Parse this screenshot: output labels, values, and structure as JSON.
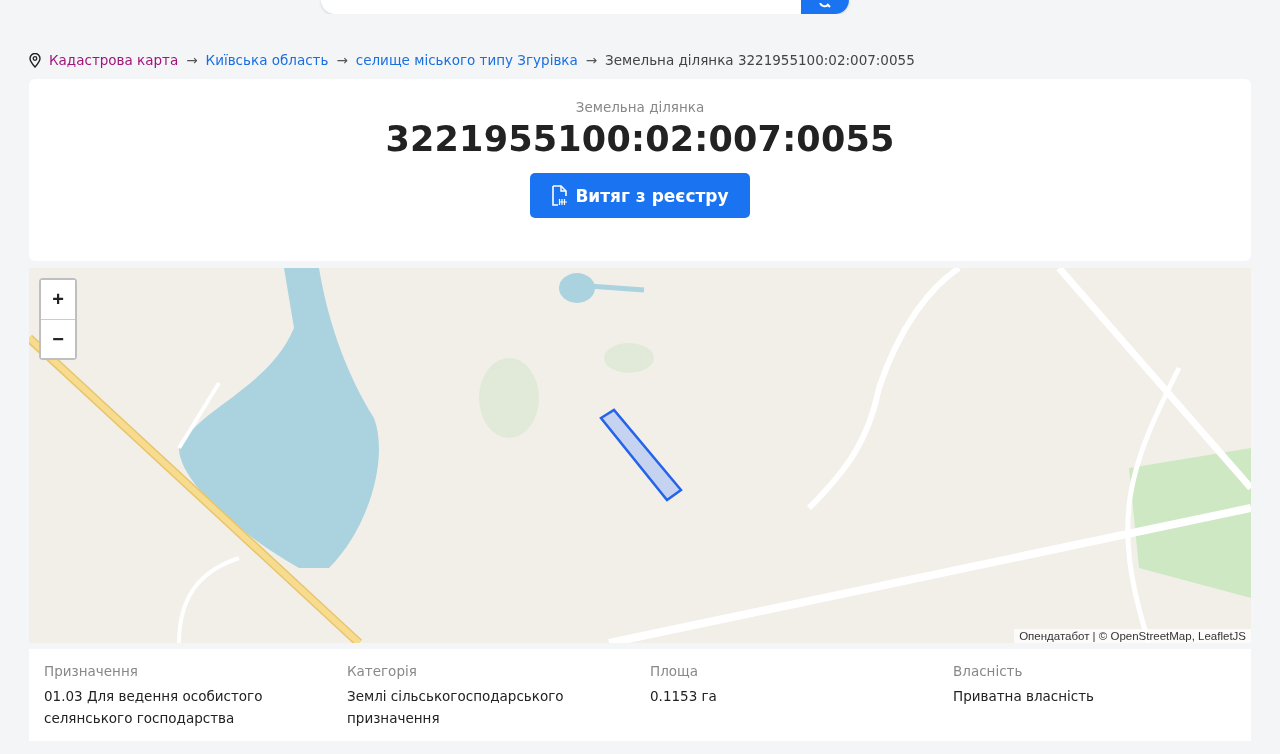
{
  "breadcrumbs": [
    {
      "label": "Кадастрова карта",
      "kind": "visited"
    },
    {
      "label": "Київська область",
      "kind": "link"
    },
    {
      "label": "селище міського типу Згурівка",
      "kind": "link"
    },
    {
      "label": "Земельна ділянка 3221955100:02:007:0055",
      "kind": "current"
    }
  ],
  "breadcrumb_separator": "→",
  "header": {
    "subtitle": "Земельна ділянка",
    "title": "3221955100:02:007:0055",
    "button": "Витяг з реєстру"
  },
  "map": {
    "zoom_in": "+",
    "zoom_out": "−",
    "attribution": "Опендатабот | © OpenStreetMap, LeafletJS"
  },
  "details": [
    {
      "label": "Призначення",
      "value": "01.03 Для ведення особистого селянського господарства"
    },
    {
      "label": "Категорія",
      "value": "Землі сільськогосподарського призначення"
    },
    {
      "label": "Площа",
      "value": "0.1153 га"
    },
    {
      "label": "Власність",
      "value": "Приватна власність"
    }
  ]
}
